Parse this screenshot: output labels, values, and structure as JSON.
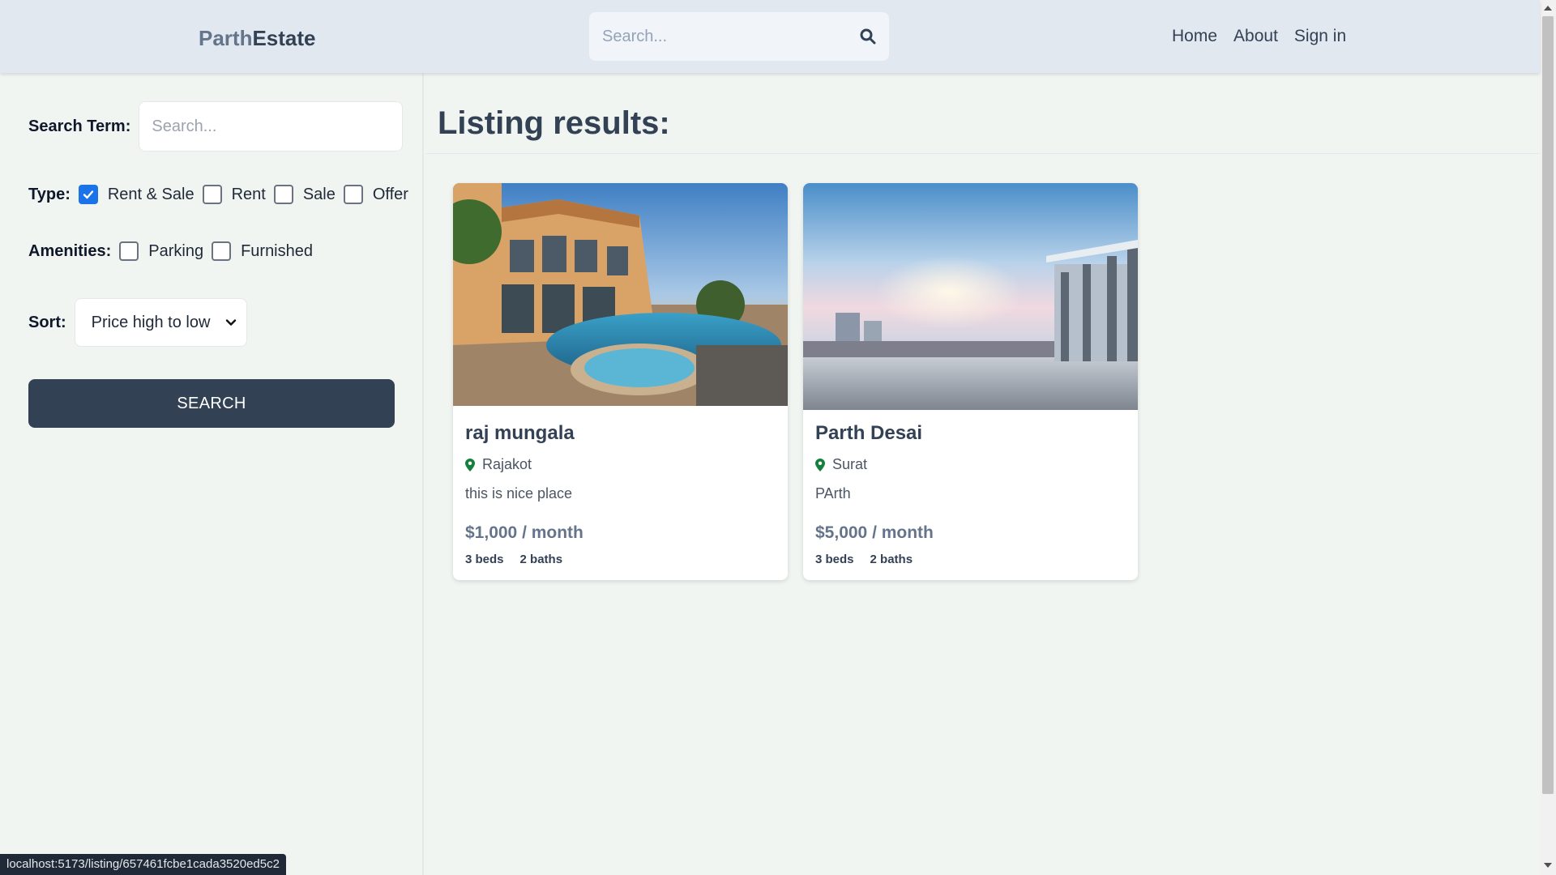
{
  "header": {
    "logo_part1": "Parth",
    "logo_part2": "Estate",
    "search_placeholder": "Search...",
    "nav": [
      "Home",
      "About",
      "Sign in"
    ]
  },
  "sidebar": {
    "search_term_label": "Search Term:",
    "search_term_placeholder": "Search...",
    "type_label": "Type:",
    "type_options": [
      {
        "label": "Rent & Sale",
        "checked": true
      },
      {
        "label": "Rent",
        "checked": false
      },
      {
        "label": "Sale",
        "checked": false
      },
      {
        "label": "Offer",
        "checked": false
      }
    ],
    "amenities_label": "Amenities:",
    "amenity_options": [
      {
        "label": "Parking",
        "checked": false
      },
      {
        "label": "Furnished",
        "checked": false
      }
    ],
    "sort_label": "Sort:",
    "sort_value": "Price high to low",
    "search_button": "SEARCH"
  },
  "main": {
    "title": "Listing results:",
    "listings": [
      {
        "name": "raj mungala",
        "location": "Rajakot",
        "description": "this is nice place",
        "price": "$1,000 / month",
        "beds": "3 beds",
        "baths": "2 baths"
      },
      {
        "name": "Parth Desai",
        "location": "Surat",
        "description": "PArth",
        "price": "$5,000 / month",
        "beds": "3 beds",
        "baths": "2 baths"
      }
    ]
  },
  "status_bar": "localhost:5173/listing/657461fcbe1cada3520ed5c2",
  "colors": {
    "accent": "#1a73e8",
    "button": "#334155",
    "pin": "#15803d"
  }
}
